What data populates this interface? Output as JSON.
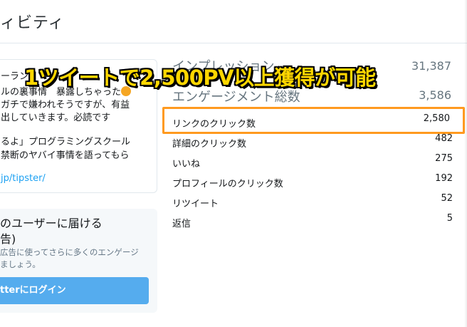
{
  "header": {
    "title": "ィビティ"
  },
  "tweet": {
    "lines": [
      "ーラン",
      "ルの裏事情　暴露しちゃった",
      "ガチで嫌われそうですが、有益",
      "出していきます。必読です",
      "るよ」プログラミングスクール",
      "禁断のヤバイ事情を語ってもら"
    ],
    "link": "jp/tipster/"
  },
  "promo": {
    "title_line1": "のユーザーに届ける",
    "title_line2": "告)",
    "desc_line1": "広告に使ってさらに多くのエンゲージ",
    "desc_line2": "ましょう。",
    "button_label": "tterにログイン"
  },
  "stats_big": [
    {
      "label": "インプレッション",
      "value": "31,387"
    },
    {
      "label": "エンゲージメント総数",
      "value": "3,586"
    }
  ],
  "stats": [
    {
      "label": "リンクのクリック数",
      "value": "2,580"
    },
    {
      "label": "詳細のクリック数",
      "value": "482"
    },
    {
      "label": "いいね",
      "value": "275"
    },
    {
      "label": "プロフィールのクリック数",
      "value": "192"
    },
    {
      "label": "リツイート",
      "value": "52"
    },
    {
      "label": "返信",
      "value": "5"
    }
  ],
  "banner": {
    "text": "1ツイートで2,500PV以上獲得が可能"
  },
  "colors": {
    "highlight": "#ff9a1f",
    "banner_fill": "#ffd700",
    "button": "#55acee",
    "link": "#1da1f2"
  }
}
